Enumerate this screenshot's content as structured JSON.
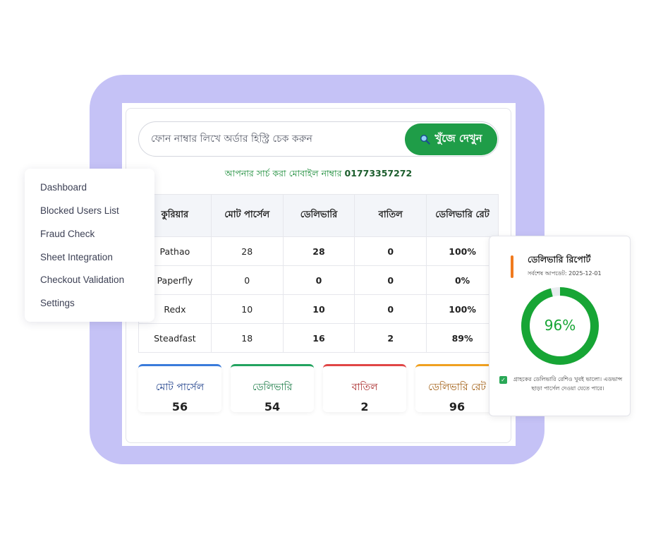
{
  "search": {
    "placeholder": "ফোন নাম্বার লিখে অর্ডার হিস্ট্রি চেক করুন",
    "button_label": "খুঁজে দেখুন",
    "icon": "search-icon"
  },
  "phone_info": {
    "label": "আপনার সার্চ করা মোবাইল নাম্বার",
    "number": "01773357272"
  },
  "table": {
    "headers": [
      "কুরিয়ার",
      "মোট পার্সেল",
      "ডেলিভারি",
      "বাতিল",
      "ডেলিভারি রেট"
    ],
    "rows": [
      {
        "courier": "Pathao",
        "total": "28",
        "delivered": "28",
        "cancelled": "0",
        "rate": "100%"
      },
      {
        "courier": "Paperfly",
        "total": "0",
        "delivered": "0",
        "cancelled": "0",
        "rate": "0%"
      },
      {
        "courier": "Redx",
        "total": "10",
        "delivered": "10",
        "cancelled": "0",
        "rate": "100%"
      },
      {
        "courier": "Steadfast",
        "total": "18",
        "delivered": "16",
        "cancelled": "2",
        "rate": "89%"
      }
    ]
  },
  "stats": [
    {
      "label": "মোট পার্সেল",
      "value": "56",
      "color": "#3a7bdb",
      "label_color": "#1d3f8a"
    },
    {
      "label": "ডেলিভারি",
      "value": "54",
      "color": "#22a35f",
      "label_color": "#1b7c47"
    },
    {
      "label": "বাতিল",
      "value": "2",
      "color": "#e04646",
      "label_color": "#a82626"
    },
    {
      "label": "ডেলিভারি রেট",
      "value": "96",
      "color": "#f0a020",
      "label_color": "#a05c10"
    }
  ],
  "menu": {
    "items": [
      "Dashboard",
      "Blocked Users List",
      "Fraud Check",
      "Sheet Integration",
      "Checkout Validation",
      "Settings"
    ]
  },
  "report": {
    "title": "ডেলিভারি রিপোর্ট",
    "updated": "সর্বশেষ আপডেট: 2025-12-01",
    "percent_label": "96%",
    "percent_value": 0.96,
    "ring_color": "#17a535",
    "note": "গ্রাহকের ডেলিভারি রেশিও খুবই ভালো। এডভান্স ছাড়া পার্সেল দেওয়া যেতে পারে।"
  }
}
